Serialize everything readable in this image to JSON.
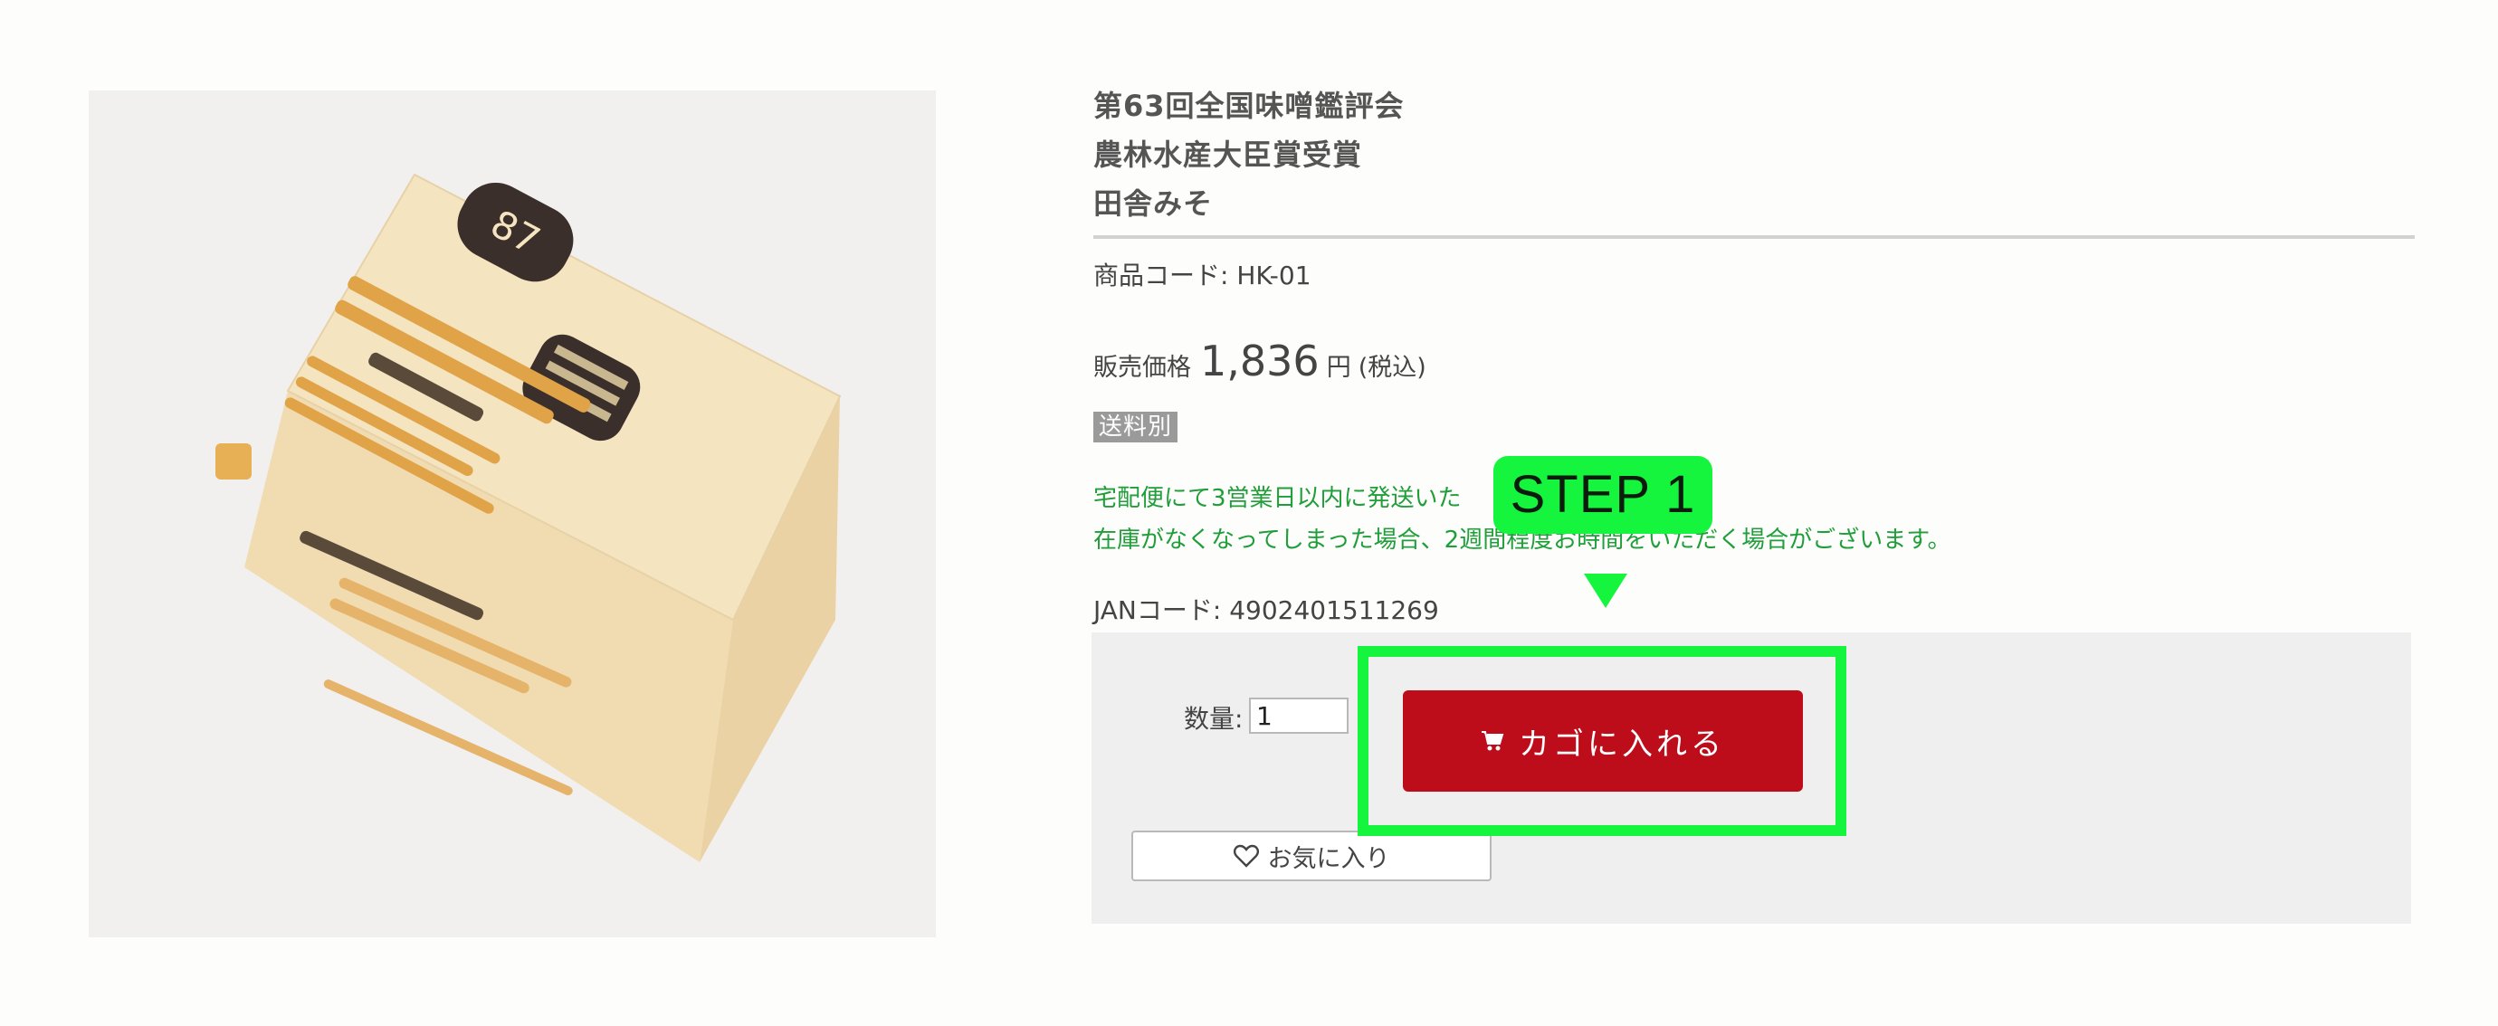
{
  "product": {
    "title_lines": [
      "第63回全国味噌鑑評会",
      "農林水産大臣賞受賞",
      "田舎みそ"
    ],
    "code_label": "商品コード: HK-01",
    "price_label": "販売価格",
    "price_amount": "1,836",
    "price_unit": "円",
    "price_tax": "(税込)",
    "shipping_badge": "送料別",
    "notice_line1": "宅配便にて3営業日以内に発送いた",
    "notice_line2": "在庫がなくなってしまった場合、2週間程度お時間をいただく場合がございます。",
    "jan_label": "JANコード: 4902401511269",
    "image_icon": "product-box-image"
  },
  "cart": {
    "qty_label": "数量:",
    "qty_value": "1",
    "add_button_label": "カゴに入れる",
    "add_button_icon": "cart-icon",
    "favorite_label": "お気に入り",
    "favorite_icon": "heart-icon"
  },
  "annotation": {
    "step_label": "STEP 1",
    "color": "#16f53e"
  },
  "colors": {
    "button_red": "#bd0d1b",
    "notice_green": "#1f9e3a",
    "panel_gray": "#efefef"
  }
}
